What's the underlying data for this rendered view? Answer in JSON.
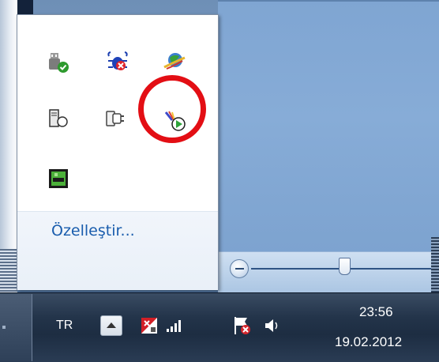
{
  "notification_area_popup": {
    "customize_label": "Özelleştir...",
    "icons": [
      {
        "name": "safely-remove-hardware-icon"
      },
      {
        "name": "network-bug-icon"
      },
      {
        "name": "internet-globe-icon"
      },
      {
        "name": "computer-device-icon"
      },
      {
        "name": "power-plug-icon"
      },
      {
        "name": "media-player-icon",
        "highlighted": true
      },
      {
        "name": "green-device-icon"
      }
    ],
    "highlight_color": "#e30e14"
  },
  "taskbar": {
    "language": "TR",
    "show_hidden_icons": "chevron-up-icon",
    "tray_icons": [
      "antivirus-flag-icon",
      "network-signal-icon",
      "action-center-flag-icon",
      "volume-icon"
    ],
    "clock": {
      "time": "23:56",
      "date": "19.02.2012"
    }
  }
}
